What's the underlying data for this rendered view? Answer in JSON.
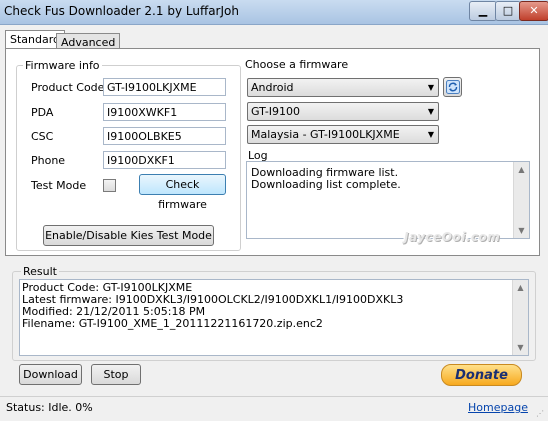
{
  "window": {
    "title": "Check Fus Downloader 2.1 by LuffarJoh"
  },
  "tabs": [
    {
      "label": "Standard"
    },
    {
      "label": "Advanced"
    }
  ],
  "firmware_info": {
    "group_label": "Firmware info",
    "fields": [
      {
        "label": "Product Code",
        "value": "GT-I9100LKJXME"
      },
      {
        "label": "PDA",
        "value": "I9100XWKF1"
      },
      {
        "label": "CSC",
        "value": "I9100OLBKE5"
      },
      {
        "label": "Phone",
        "value": "I9100DXKF1"
      }
    ],
    "test_mode_label": "Test Mode",
    "check_button": "Check firmware",
    "kies_button": "Enable/Disable Kies Test Mode"
  },
  "choose": {
    "group_label": "Choose a firmware",
    "os": "Android",
    "model": "GT-I9100",
    "region": "Malaysia - GT-I9100LKJXME",
    "refresh_icon": "refresh-icon"
  },
  "log": {
    "label": "Log",
    "lines": [
      "Downloading firmware list.",
      "Downloading list complete."
    ]
  },
  "watermark": "JayceOoi.com",
  "result": {
    "label": "Result",
    "lines": [
      "Product Code: GT-I9100LKJXME",
      "Latest firmware: I9100DXKL3/I9100OLCKL2/I9100DXKL1/I9100DXKL3",
      "Modified: 21/12/2011 5:05:18 PM",
      "Filename: GT-I9100_XME_1_20111221161720.zip.enc2"
    ]
  },
  "buttons": {
    "download": "Download",
    "stop": "Stop",
    "donate": "Donate"
  },
  "status": {
    "text": "Status: Idle.  0%",
    "homepage": "Homepage"
  },
  "colors": {
    "donate_bg": "#f7a91e",
    "donate_text": "#1a2f73",
    "title_bar": "#b9d1ea"
  }
}
